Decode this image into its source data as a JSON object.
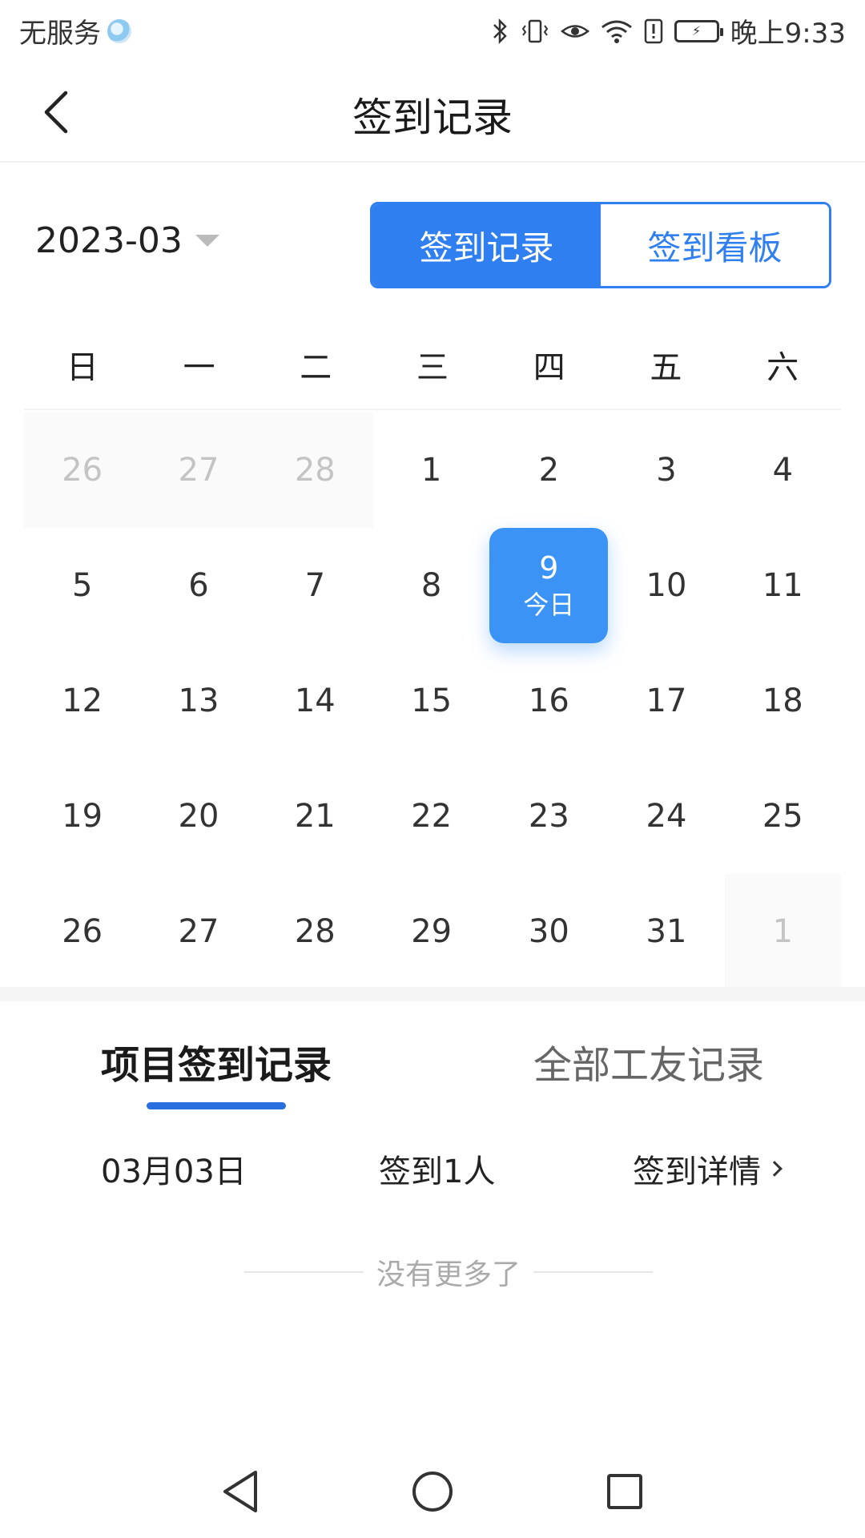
{
  "status_bar": {
    "carrier": "无服务",
    "time": "晚上9:33",
    "icons": [
      "bluetooth-icon",
      "vibrate-icon",
      "eye-comfort-icon",
      "wifi-icon",
      "alert-icon",
      "battery-icon"
    ]
  },
  "header": {
    "title": "签到记录",
    "back_icon": "chevron-left-icon"
  },
  "month_picker": {
    "value": "2023-03"
  },
  "segment": {
    "options": [
      "签到记录",
      "签到看板"
    ],
    "selected": "签到记录"
  },
  "calendar": {
    "weekdays": [
      "日",
      "一",
      "二",
      "三",
      "四",
      "五",
      "六"
    ],
    "days": [
      {
        "label": "26",
        "other": true
      },
      {
        "label": "27",
        "other": true
      },
      {
        "label": "28",
        "other": true
      },
      {
        "label": "1"
      },
      {
        "label": "2"
      },
      {
        "label": "3"
      },
      {
        "label": "4"
      },
      {
        "label": "5"
      },
      {
        "label": "6"
      },
      {
        "label": "7"
      },
      {
        "label": "8"
      },
      {
        "label": "9",
        "today": true,
        "today_label": "今日"
      },
      {
        "label": "10"
      },
      {
        "label": "11"
      },
      {
        "label": "12"
      },
      {
        "label": "13"
      },
      {
        "label": "14"
      },
      {
        "label": "15"
      },
      {
        "label": "16"
      },
      {
        "label": "17"
      },
      {
        "label": "18"
      },
      {
        "label": "19"
      },
      {
        "label": "20"
      },
      {
        "label": "21"
      },
      {
        "label": "22"
      },
      {
        "label": "23"
      },
      {
        "label": "24"
      },
      {
        "label": "25"
      },
      {
        "label": "26"
      },
      {
        "label": "27"
      },
      {
        "label": "28"
      },
      {
        "label": "29"
      },
      {
        "label": "30"
      },
      {
        "label": "31"
      },
      {
        "label": "1",
        "other": true
      }
    ],
    "accent_color": "#3b93f5"
  },
  "tabs": {
    "project": "项目签到记录",
    "all": "全部工友记录",
    "selected": "项目签到记录"
  },
  "record": {
    "date": "03月03日",
    "count": "签到1人",
    "detail": "签到详情"
  },
  "footer_text": "没有更多了",
  "colors": {
    "primary": "#2f7ff0",
    "underline": "#2a6fe0"
  }
}
